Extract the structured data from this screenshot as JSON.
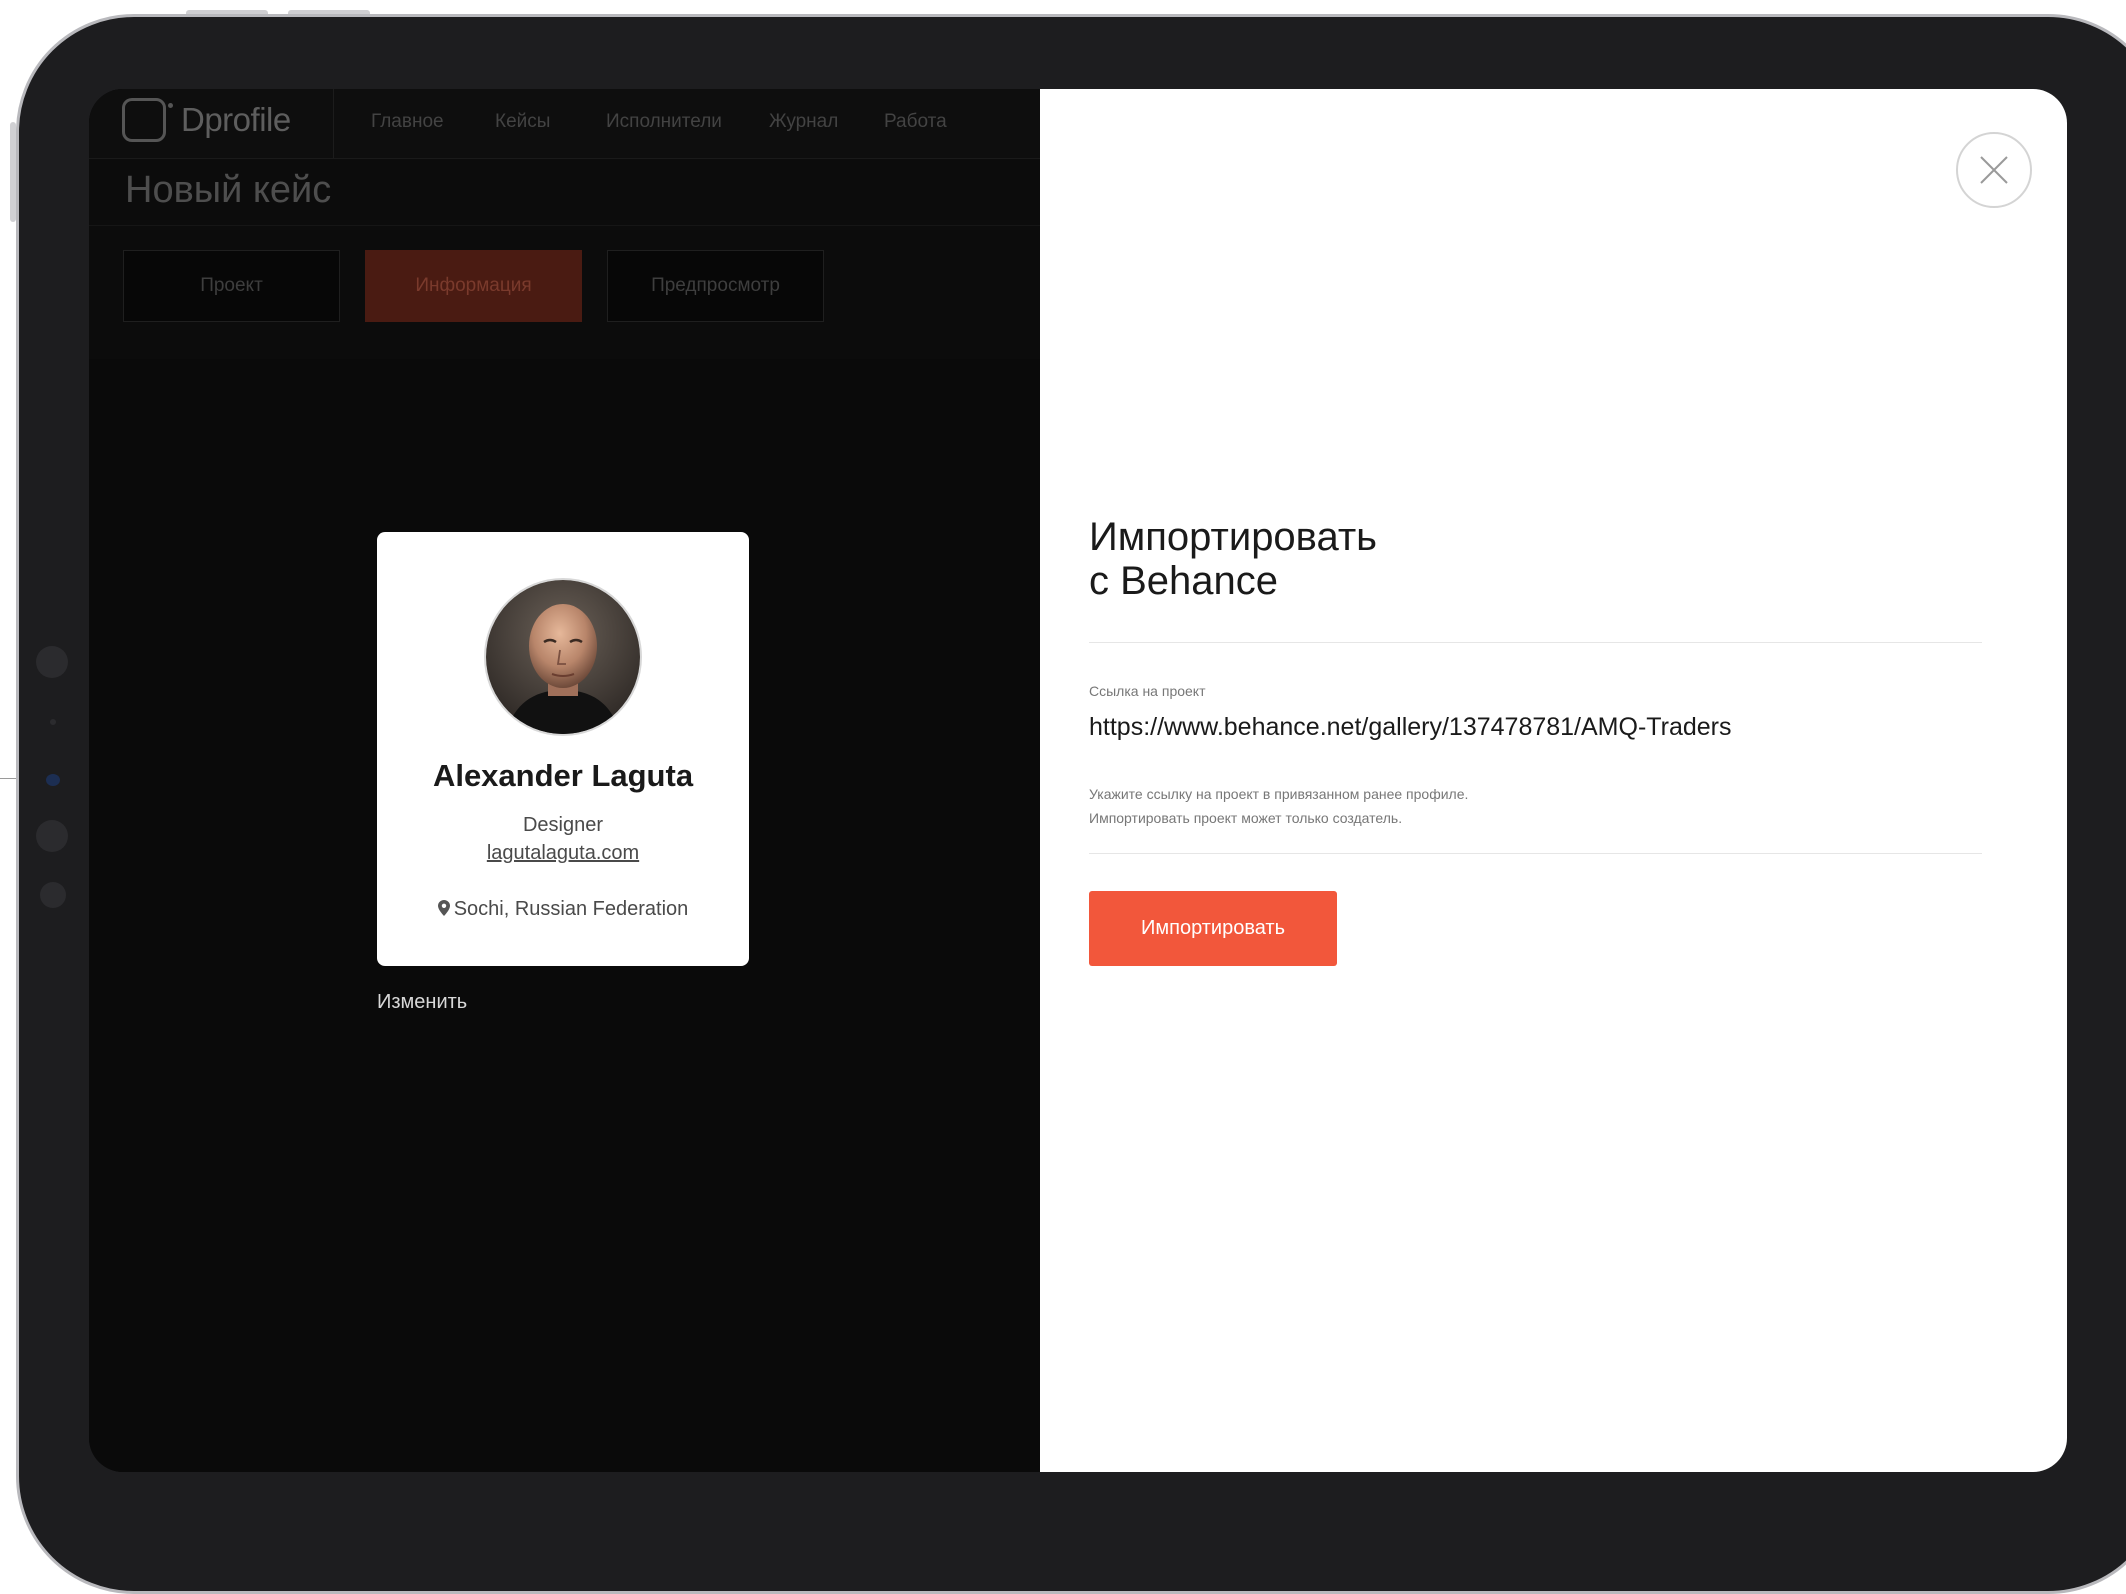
{
  "nav": {
    "logo": "Dprofile",
    "items": [
      "Главное",
      "Кейсы",
      "Исполнители",
      "Журнал",
      "Работа"
    ]
  },
  "page": {
    "title": "Новый кейс"
  },
  "tabs": [
    {
      "label": "Проект",
      "active": false
    },
    {
      "label": "Информация",
      "active": true
    },
    {
      "label": "Предпросмотр",
      "active": false
    }
  ],
  "profile_card": {
    "name": "Alexander Laguta",
    "role": "Designer",
    "website": "lagutalaguta.com",
    "location": "Sochi, Russian Federation",
    "avatar_icon": "avatar-photo"
  },
  "edit_label": "Изменить",
  "modal": {
    "title_line1": "Импортировать",
    "title_line2": "с Behance",
    "field_label": "Ссылка на проект",
    "field_value": "https://www.behance.net/gallery/137478781/AMQ-Traders",
    "hint_line1": "Укажите ссылку на проект в привязанном ранее профиле.",
    "hint_line2": "Импортировать проект может только создатель.",
    "button_label": "Импортировать",
    "close_icon": "close-icon"
  },
  "colors": {
    "accent": "#f2573b",
    "panel_bg": "#ffffff",
    "app_bg": "#0a0a0a"
  }
}
